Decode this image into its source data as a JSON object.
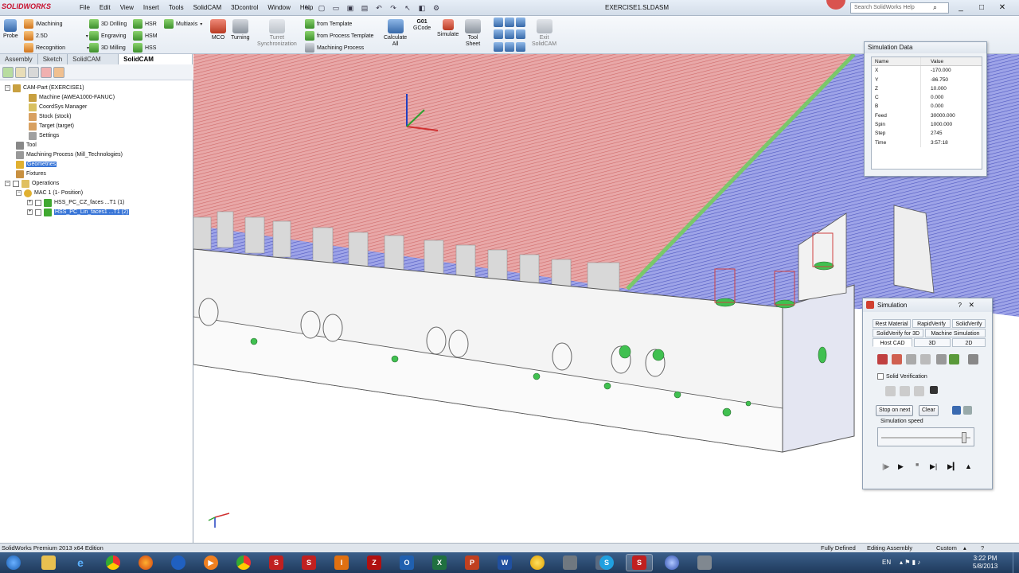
{
  "app": {
    "logo_text": "SOLIDWORKS",
    "doc_title": "EXERCISE1.SLDASM",
    "menu": [
      "File",
      "Edit",
      "View",
      "Insert",
      "Tools",
      "SolidCAM",
      "3Dcontrol",
      "Window",
      "Help"
    ],
    "search_placeholder": "Search SolidWorks Help",
    "window_controls": [
      "_",
      "□",
      "✕"
    ]
  },
  "command_manager": {
    "probe": "Probe",
    "col1": [
      "iMachining",
      "2.5D",
      "Recognition"
    ],
    "col2": [
      "3D Drilling",
      "Engraving",
      "3D Milling"
    ],
    "col3": [
      "HSR",
      "HSM",
      "HSS"
    ],
    "multiaxis": "Multiaxis",
    "mco": "MCO",
    "turning": "Turning",
    "turret_sync": [
      "Turret",
      "Synchronization"
    ],
    "templates": [
      "from Template",
      "from Process Template",
      "Machining Process"
    ],
    "calculate_all": [
      "Calculate",
      "All"
    ],
    "gcode": [
      "G01",
      "GCode"
    ],
    "simulate": "Simulate",
    "tool_sheet": [
      "Tool",
      "Sheet"
    ],
    "exit_solidcam": [
      "Exit",
      "SolidCAM"
    ]
  },
  "tabs": [
    "Assembly",
    "Sketch",
    "SolidCAM Part",
    "SolidCAM Operations"
  ],
  "tree": {
    "cam_part": "CAM-Part (EXERCISE1)",
    "machine": "Machine (AWEA1000-FANUC)",
    "coordsys": "CoordSys Manager",
    "stock": "Stock (stock)",
    "target": "Target (target)",
    "settings": "Settings",
    "tool": "Tool",
    "machining_process": "Machining Process (Mill_Technologies)",
    "geometries": "Geometries",
    "fixtures": "Fixtures",
    "operations": "Operations",
    "mac1": "MAC 1 (1- Position)",
    "op1": "HSS_PC_CZ_faces ...T1 (1)",
    "op2": "HSS_PC_Lin_faces1 ...T1 (2)"
  },
  "simulation_data": {
    "title": "Simulation Data",
    "headers": [
      "Name",
      "Value"
    ],
    "rows": [
      [
        "X",
        "-170.000"
      ],
      [
        "Y",
        "-86.750"
      ],
      [
        "Z",
        "10.000"
      ],
      [
        "C",
        "0.000"
      ],
      [
        "B",
        "0.000"
      ],
      [
        "Feed",
        "30000.000"
      ],
      [
        "Spin",
        "1000.000"
      ],
      [
        "Step",
        "2745"
      ],
      [
        "Time",
        "3:57:18"
      ]
    ]
  },
  "simulation": {
    "title": "Simulation",
    "tabs_row1": [
      "Rest Material",
      "RapidVerify",
      "SolidVerify"
    ],
    "tabs_row2": [
      "SolidVerify for 3D",
      "Machine Simulation"
    ],
    "tabs_row3": [
      "Host CAD",
      "3D",
      "2D"
    ],
    "solid_verification": "Solid Verification",
    "stop_on_next": "Stop on next",
    "clear": "Clear",
    "speed_label": "Simulation speed",
    "speed_level": 0.95,
    "controls": [
      "|▶",
      "▶",
      "■",
      "▶|",
      "▶▎",
      "▲"
    ]
  },
  "status": {
    "edition": "SolidWorks Premium 2013 x64 Edition",
    "fully_defined": "Fully Defined",
    "editing": "Editing Assembly",
    "custom": "Custom",
    "help_icon": "?"
  },
  "taskbar": {
    "lang": "EN",
    "time": "3:22 PM",
    "date": "5/8/2013",
    "apps": [
      "start",
      "explorer",
      "ie",
      "chrome",
      "firefox",
      "teamviewer",
      "media",
      "chrome2",
      "sw",
      "sw",
      "inventor",
      "filezilla",
      "outlook",
      "excel",
      "powerpoint",
      "word",
      "flower",
      "remote",
      "cam",
      "skype",
      "sw-active",
      "wheel",
      "snip"
    ]
  },
  "colors": {
    "accent_red": "#c8102e",
    "toolpath_red": "#d87878",
    "toolpath_blue": "#5b63c9",
    "selection": "#3875d7"
  }
}
